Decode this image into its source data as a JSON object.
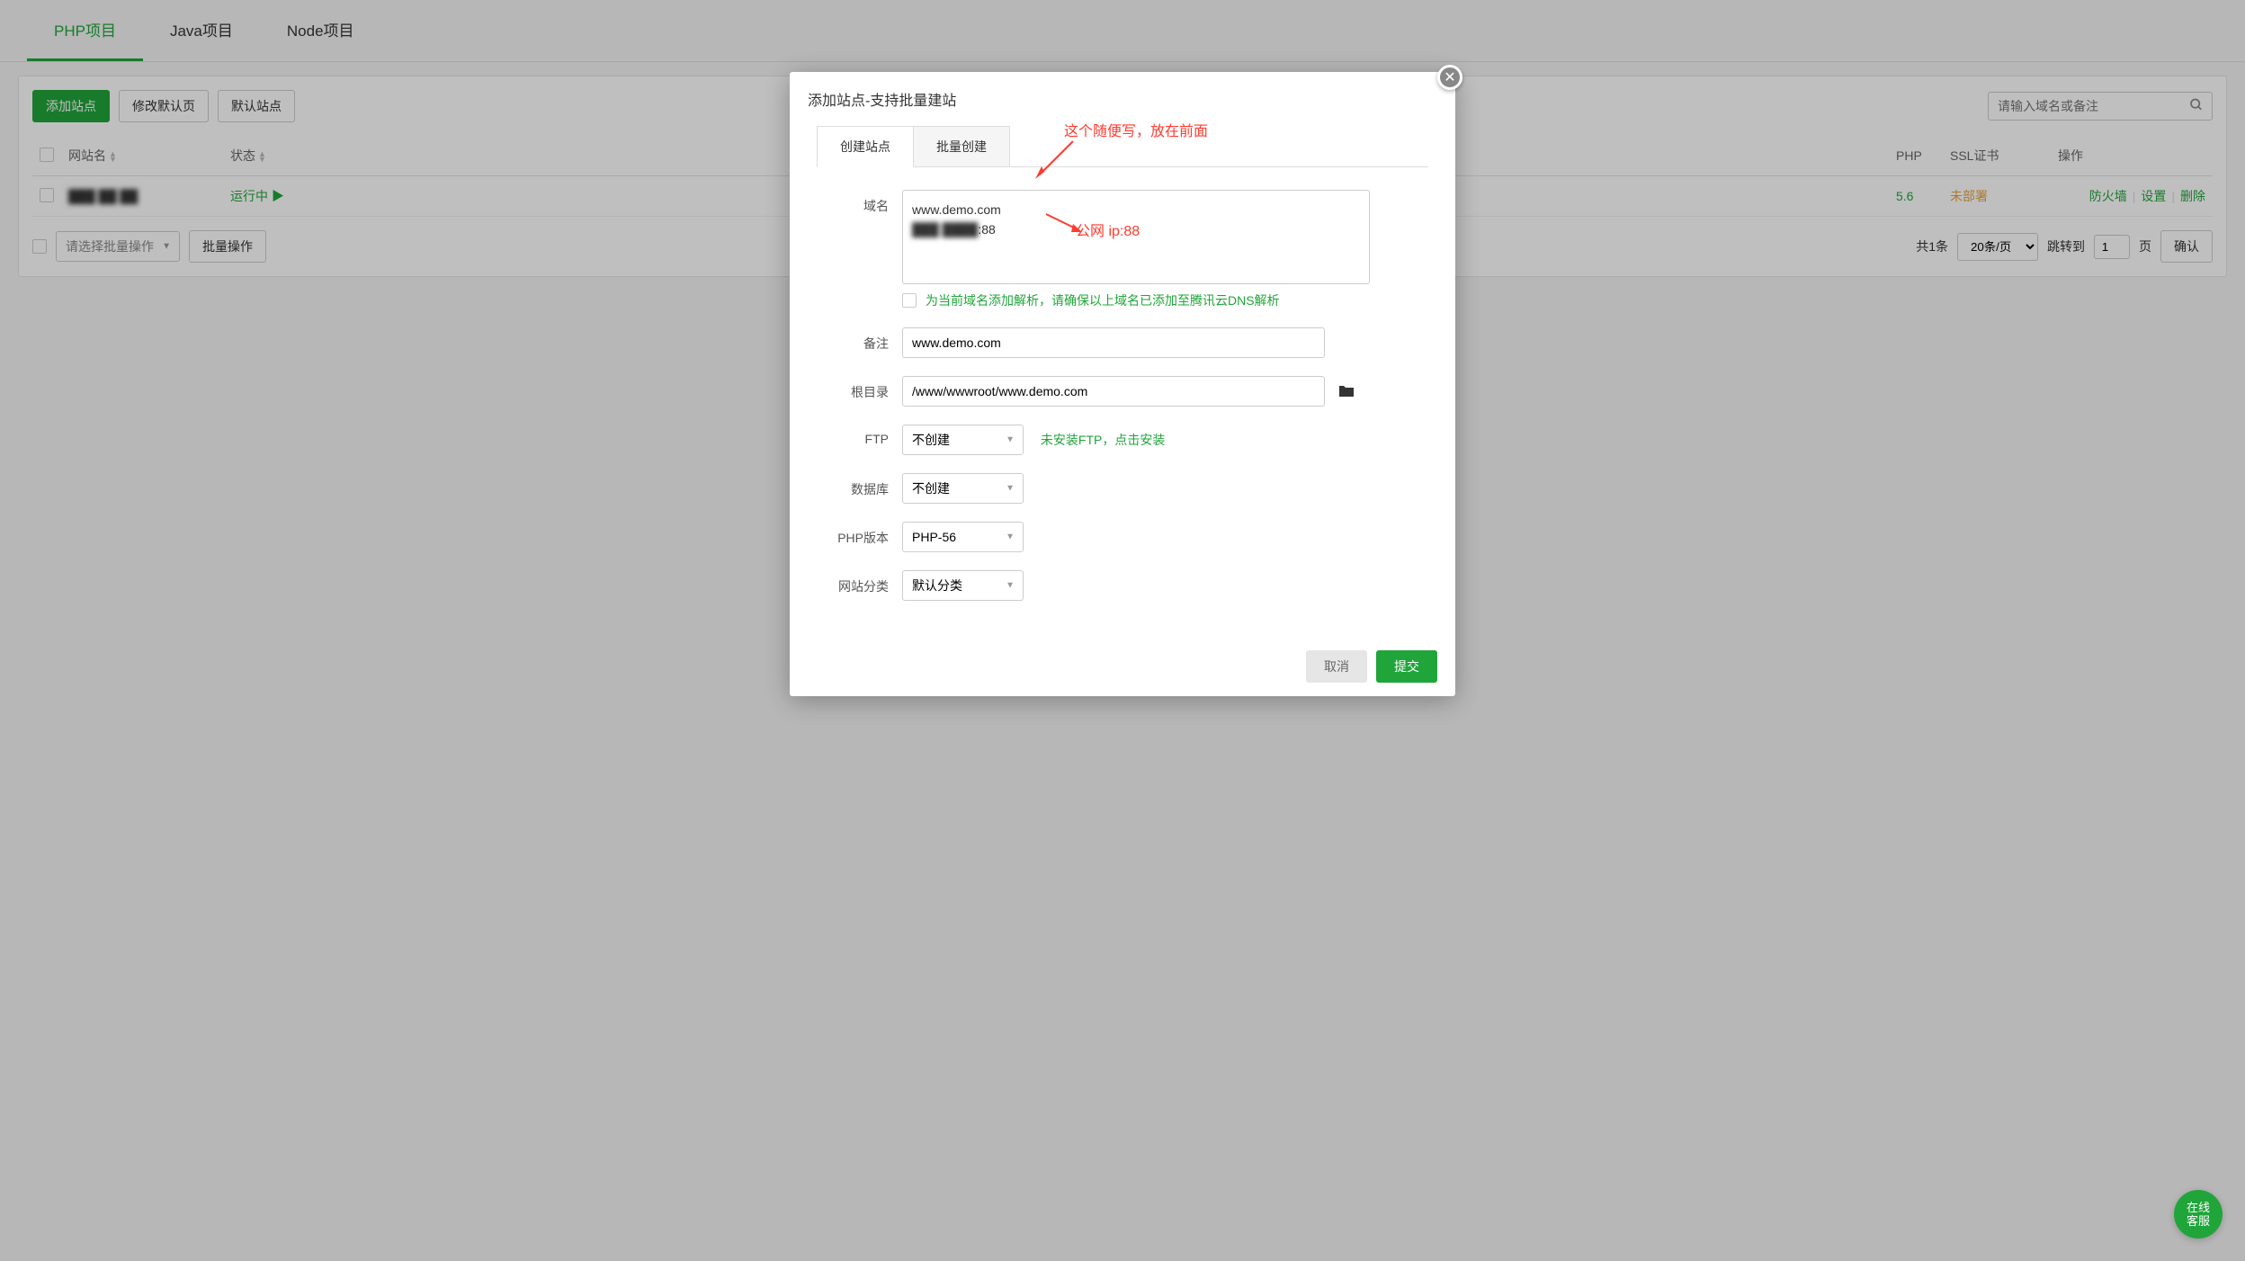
{
  "tabs": {
    "php": "PHP项目",
    "java": "Java项目",
    "node": "Node项目"
  },
  "toolbar": {
    "add_site": "添加站点",
    "modify_default": "修改默认页",
    "default_site": "默认站点",
    "search_placeholder": "请输入域名或备注"
  },
  "table": {
    "headers": {
      "site_name": "网站名",
      "status": "状态",
      "php": "PHP",
      "ssl": "SSL证书",
      "actions": "操作"
    },
    "row": {
      "site": "███ ██ ██",
      "status": "运行中 ▶",
      "php": "5.6",
      "ssl": "未部署",
      "action_firewall": "防火墙",
      "action_settings": "设置",
      "action_delete": "删除"
    }
  },
  "pagination": {
    "batch_select_placeholder": "请选择批量操作",
    "batch_action": "批量操作",
    "total": "共1条",
    "per_page": "20条/页",
    "jump_to": "跳转到",
    "page_value": "1",
    "page_unit": "页",
    "confirm": "确认"
  },
  "dialog": {
    "title": "添加站点-支持批量建站",
    "tabs": {
      "create": "创建站点",
      "batch": "批量创建"
    },
    "labels": {
      "domain": "域名",
      "remark": "备注",
      "root": "根目录",
      "ftp": "FTP",
      "database": "数据库",
      "php_version": "PHP版本",
      "category": "网站分类"
    },
    "values": {
      "domain_line1": "www.demo.com",
      "domain_line2_obscured": "███ ████",
      "domain_line2_suffix": ":88",
      "remark": "www.demo.com",
      "root": "/www/wwwroot/www.demo.com",
      "ftp": "不创建",
      "database": "不创建",
      "php_version": "PHP-56",
      "category": "默认分类"
    },
    "dns_hint": "为当前域名添加解析，请确保以上域名已添加至腾讯云DNS解析",
    "ftp_hint": "未安装FTP，点击安装",
    "annotations": {
      "top": "这个随便写，放在前面",
      "bottom": "公网 ip:88"
    },
    "buttons": {
      "cancel": "取消",
      "submit": "提交"
    }
  },
  "support": {
    "line1": "在线",
    "line2": "客服"
  }
}
